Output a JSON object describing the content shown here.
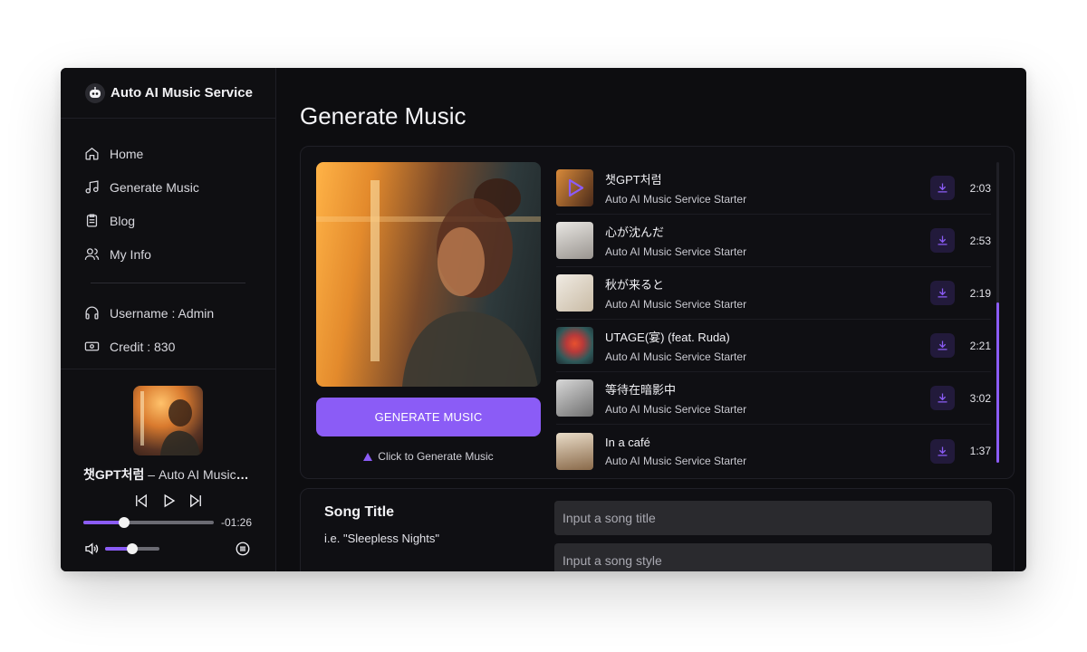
{
  "app": {
    "title": "Auto AI Music Service"
  },
  "sidebar": {
    "nav": [
      {
        "label": "Home",
        "icon": "home-icon"
      },
      {
        "label": "Generate Music",
        "icon": "music-note-icon"
      },
      {
        "label": "Blog",
        "icon": "clipboard-icon"
      },
      {
        "label": "My Info",
        "icon": "users-icon"
      }
    ],
    "username": "Username : Admin",
    "credit": "Credit : 830"
  },
  "player": {
    "title": "챗GPT처럼",
    "subtitle": " – Auto AI Music Service Starter",
    "remaining": "-01:26",
    "progress": 0.31,
    "volume": 0.5
  },
  "main": {
    "page_title": "Generate Music",
    "generate_label": "GENERATE MUSIC",
    "generate_hint": "Click to Generate Music",
    "tracks": [
      {
        "name": "챗GPT처럼",
        "artist": "Auto AI Music Service Starter",
        "duration": "2:03"
      },
      {
        "name": "心が沈んだ",
        "artist": "Auto AI Music Service Starter",
        "duration": "2:53"
      },
      {
        "name": "秋が来ると",
        "artist": "Auto AI Music Service Starter",
        "duration": "2:19"
      },
      {
        "name": "UTAGE(宴) (feat. Ruda)",
        "artist": "Auto AI Music Service Starter",
        "duration": "2:21"
      },
      {
        "name": "等待在暗影中",
        "artist": "Auto AI Music Service Starter",
        "duration": "3:02"
      },
      {
        "name": "In a café",
        "artist": "Auto AI Music Service Starter",
        "duration": "1:37"
      }
    ],
    "form": {
      "label": "Song Title",
      "example": "i.e. \"Sleepless Nights\"",
      "title_placeholder": "Input a song title",
      "style_placeholder": "Input a song style"
    }
  },
  "colors": {
    "accent": "#8b5cf6",
    "background": "#0d0d10"
  }
}
